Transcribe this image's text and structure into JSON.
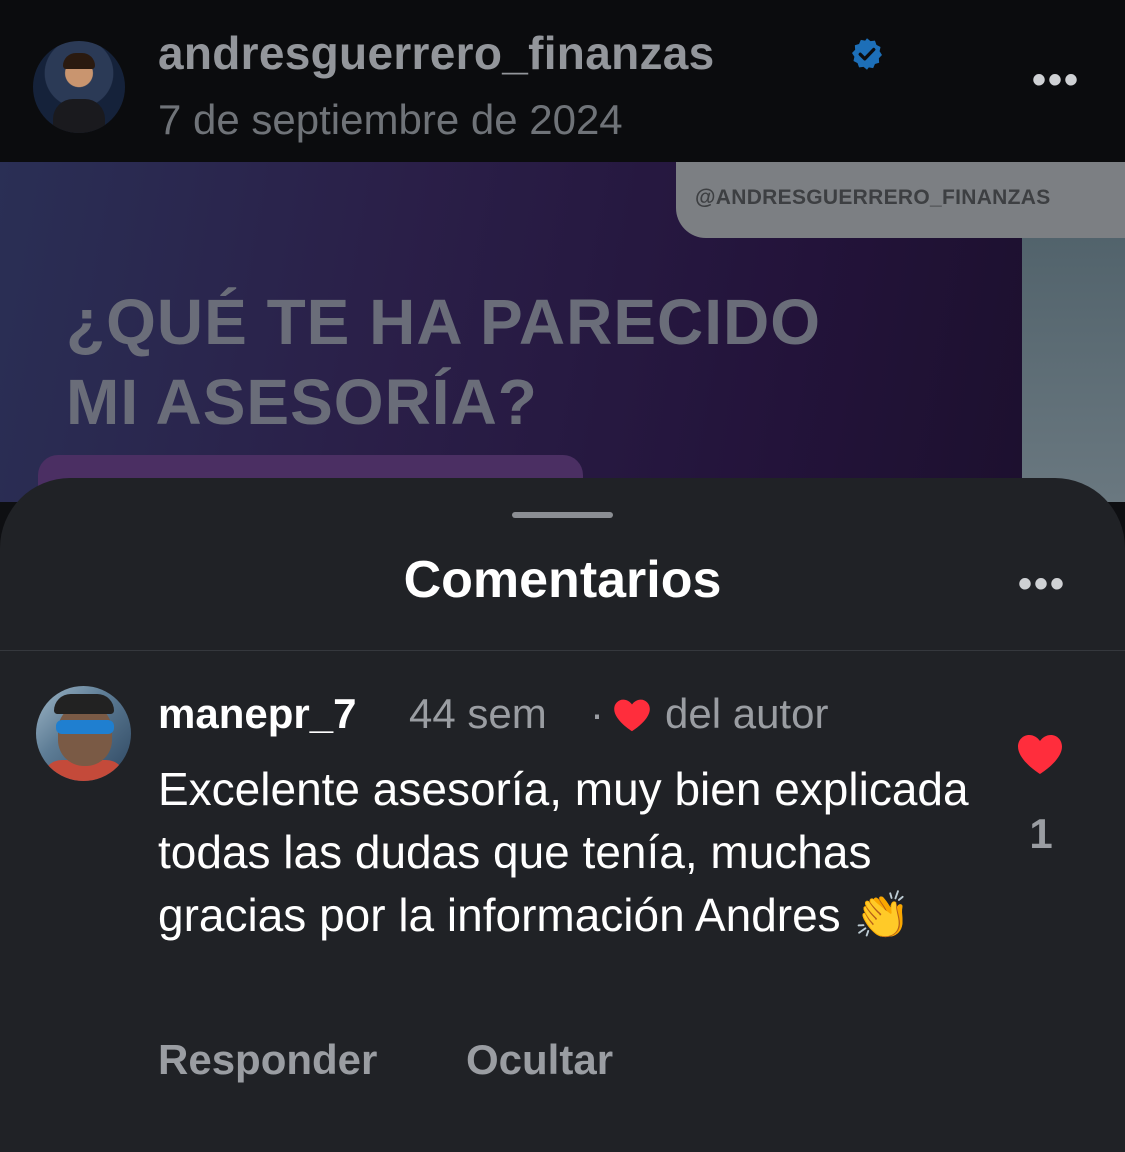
{
  "post": {
    "username": "andresguerrero_finanzas",
    "date": "7 de septiembre de 2024",
    "more_icon": "more-horizontal-icon",
    "verified_icon": "verified-badge-icon",
    "image_handle": "@ANDRESGUERRERO_FINANZAS",
    "image_headline_line1": "¿QUÉ TE HA PARECIDO",
    "image_headline_line2": "MI ASESORÍA?"
  },
  "sheet": {
    "title": "Comentarios",
    "more_icon": "more-horizontal-icon"
  },
  "comment": {
    "username": "manepr_7",
    "time": "44 sem",
    "separator": "·",
    "liked_by_author_label": "del autor",
    "text": "Excelente asesoría, muy bien explicada todas las dudas que tenía, muchas gracias por la información Andres 👏",
    "like_count": "1",
    "reply_label": "Responder",
    "hide_label": "Ocultar"
  },
  "colors": {
    "sheet_bg": "#202226",
    "heart_red": "#ff2d3c",
    "verified_blue": "#1d9bf0"
  }
}
